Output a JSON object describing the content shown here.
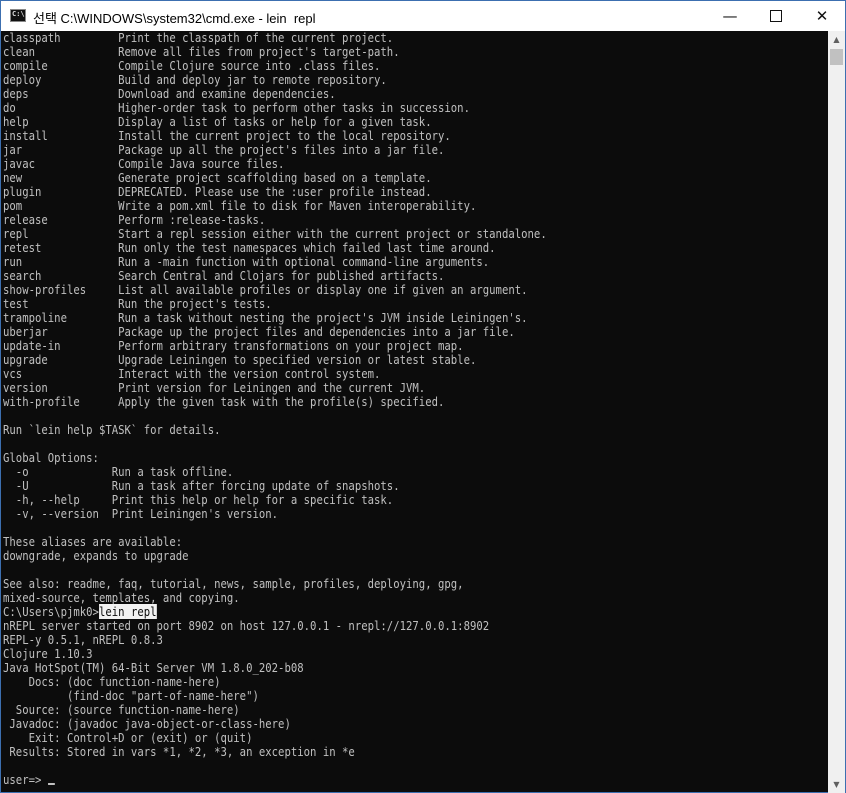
{
  "window": {
    "title": "선택 C:\\WINDOWS\\system32\\cmd.exe - lein  repl",
    "app_icon_text": "C:\\",
    "minimize_glyph": "—",
    "close_glyph": "✕"
  },
  "scrollbar": {
    "up_glyph": "▲",
    "down_glyph": "▼"
  },
  "terminal": {
    "lines": [
      "classpath         Print the classpath of the current project.",
      "clean             Remove all files from project's target-path.",
      "compile           Compile Clojure source into .class files.",
      "deploy            Build and deploy jar to remote repository.",
      "deps              Download and examine dependencies.",
      "do                Higher-order task to perform other tasks in succession.",
      "help              Display a list of tasks or help for a given task.",
      "install           Install the current project to the local repository.",
      "jar               Package up all the project's files into a jar file.",
      "javac             Compile Java source files.",
      "new               Generate project scaffolding based on a template.",
      "plugin            DEPRECATED. Please use the :user profile instead.",
      "pom               Write a pom.xml file to disk for Maven interoperability.",
      "release           Perform :release-tasks.",
      "repl              Start a repl session either with the current project or standalone.",
      "retest            Run only the test namespaces which failed last time around.",
      "run               Run a -main function with optional command-line arguments.",
      "search            Search Central and Clojars for published artifacts.",
      "show-profiles     List all available profiles or display one if given an argument.",
      "test              Run the project's tests.",
      "trampoline        Run a task without nesting the project's JVM inside Leiningen's.",
      "uberjar           Package up the project files and dependencies into a jar file.",
      "update-in         Perform arbitrary transformations on your project map.",
      "upgrade           Upgrade Leiningen to specified version or latest stable.",
      "vcs               Interact with the version control system.",
      "version           Print version for Leiningen and the current JVM.",
      "with-profile      Apply the given task with the profile(s) specified.",
      "",
      "Run `lein help $TASK` for details.",
      "",
      "Global Options:",
      "  -o             Run a task offline.",
      "  -U             Run a task after forcing update of snapshots.",
      "  -h, --help     Print this help or help for a specific task.",
      "  -v, --version  Print Leiningen's version.",
      "",
      "These aliases are available:",
      "downgrade, expands to upgrade",
      "",
      "See also: readme, faq, tutorial, news, sample, profiles, deploying, gpg,",
      "mixed-source, templates, and copying."
    ],
    "prompt": "C:\\Users\\pjmk0>",
    "command": "lein repl",
    "repl_lines": [
      "nREPL server started on port 8902 on host 127.0.0.1 - nrepl://127.0.0.1:8902",
      "REPL-y 0.5.1, nREPL 0.8.3",
      "Clojure 1.10.3",
      "Java HotSpot(TM) 64-Bit Server VM 1.8.0_202-b08",
      "    Docs: (doc function-name-here)",
      "          (find-doc \"part-of-name-here\")",
      "  Source: (source function-name-here)",
      " Javadoc: (javadoc java-object-or-class-here)",
      "    Exit: Control+D or (exit) or (quit)",
      " Results: Stored in vars *1, *2, *3, an exception in *e",
      ""
    ],
    "repl_prompt": "user=> "
  }
}
